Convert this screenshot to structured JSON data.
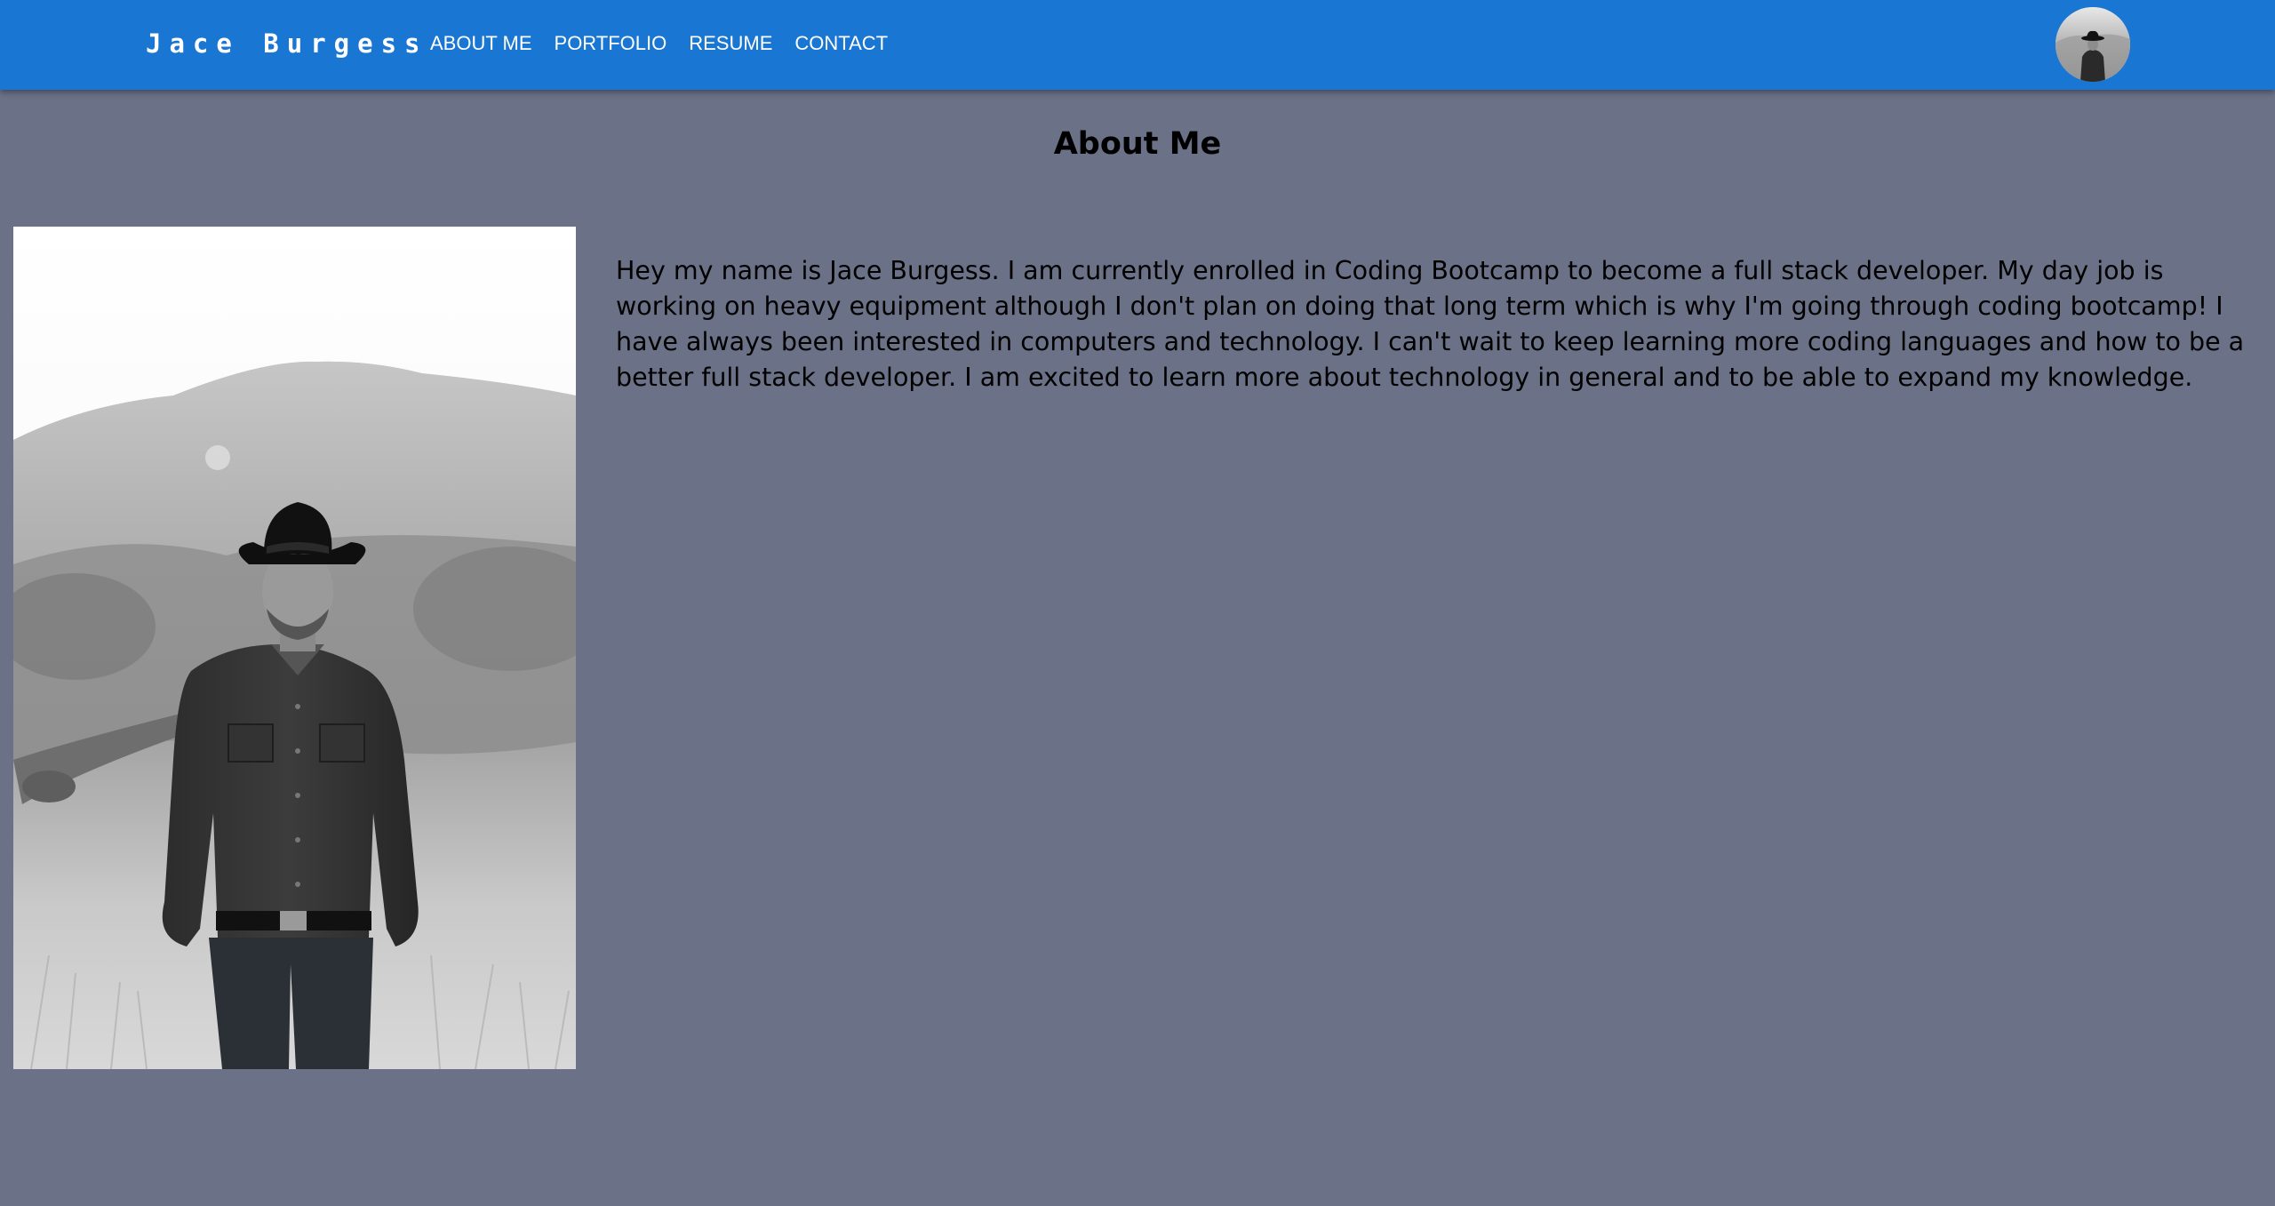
{
  "navbar": {
    "brand": "Jace Burgess",
    "links": [
      {
        "label": "ABOUT ME"
      },
      {
        "label": "PORTFOLIO"
      },
      {
        "label": "RESUME"
      },
      {
        "label": "CONTACT"
      }
    ],
    "avatar_icon": "profile-photo",
    "background_color": "#1976d2"
  },
  "main": {
    "title": "About Me",
    "photo_icon": "portrait-photo",
    "bio": "Hey my name is Jace Burgess. I am currently enrolled in Coding Bootcamp to become a full stack developer. My day job is working on heavy equipment although I don't plan on doing that long term which is why I'm going through coding bootcamp! I have always been interested in computers and technology. I can't wait to keep learning more coding languages and how to be a better full stack developer. I am excited to learn more about technology in general and to be able to expand my knowledge.",
    "background_color": "#6b7187"
  }
}
